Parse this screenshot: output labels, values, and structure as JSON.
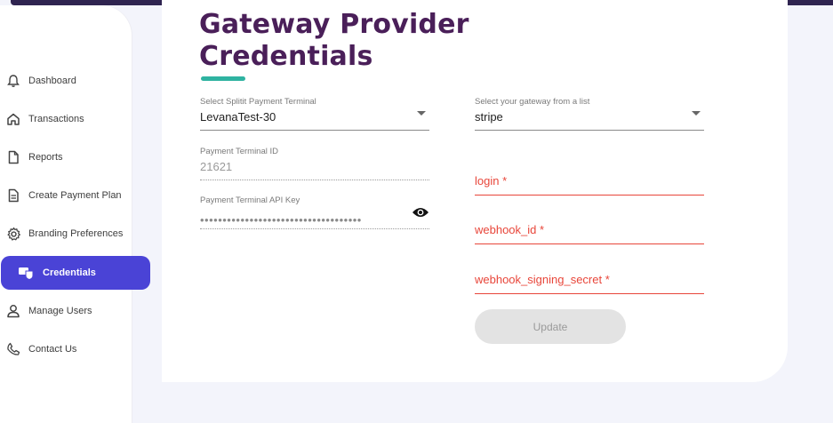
{
  "sidebar": {
    "items": [
      {
        "label": "Dashboard",
        "icon": "bell-icon"
      },
      {
        "label": "Transactions",
        "icon": "home-icon"
      },
      {
        "label": "Reports",
        "icon": "document-icon"
      },
      {
        "label": "Create Payment Plan",
        "icon": "file-list-icon"
      },
      {
        "label": "Branding Preferences",
        "icon": "gear-icon"
      },
      {
        "label": "Credentials",
        "icon": "credential-icon",
        "active": true
      },
      {
        "label": "Manage Users",
        "icon": "user-icon"
      },
      {
        "label": "Contact Us",
        "icon": "phone-icon"
      }
    ]
  },
  "page": {
    "title": "Gateway Provider Credentials"
  },
  "form": {
    "terminal_label": "Select Splitit Payment Terminal",
    "terminal_value": "LevanaTest-30",
    "gateway_label": "Select your gateway from a list",
    "gateway_value": "stripe",
    "terminal_id_label": "Payment Terminal ID",
    "terminal_id_value": "21621",
    "api_key_label": "Payment Terminal API Key",
    "api_key_value": "••••••••••••••••••••••••••••••••••••",
    "login_label": "login *",
    "webhook_id_label": "webhook_id *",
    "webhook_secret_label": "webhook_signing_secret *",
    "update_label": "Update"
  },
  "colors": {
    "accent": "#4a43d6",
    "title": "#4a1f59",
    "underline": "#2fb3a1",
    "error": "#e8463a"
  }
}
